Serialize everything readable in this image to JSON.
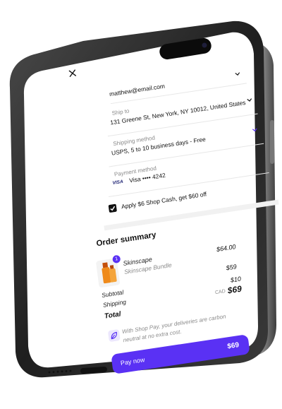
{
  "checkout": {
    "email": "matthew@email.com",
    "ship_to_label": "Ship to",
    "ship_to_value": "131 Greene St, New York, NY 10012, United States",
    "shipping_label": "Shipping method",
    "shipping_value": "USPS, 5 to 10 business days - Free",
    "payment_label": "Payment method",
    "payment_brand": "VISA",
    "payment_value": "Visa •••• 4242",
    "shop_cash_text": "Apply $6 Shop Cash, get $60 off"
  },
  "order_summary": {
    "title": "Order summary",
    "item_qty": "1",
    "item_name": "Skinscape",
    "item_variant": "Skinscape Bundle",
    "item_price": "$64.00",
    "subtotal_label": "Subtotal",
    "subtotal_value": "$59",
    "shipping_label": "Shipping",
    "shipping_value": "$10",
    "total_label": "Total",
    "total_currency": "CAD",
    "total_value": "$69",
    "carbon_text_1": "With Shop Pay, your deliveries are carbon",
    "carbon_text_2": "neutral at no extra cost."
  },
  "pay_button": {
    "label": "Pay now",
    "amount": "$69"
  },
  "colors": {
    "accent": "#5a31f4",
    "phone_frame": "#2b2b2b"
  }
}
